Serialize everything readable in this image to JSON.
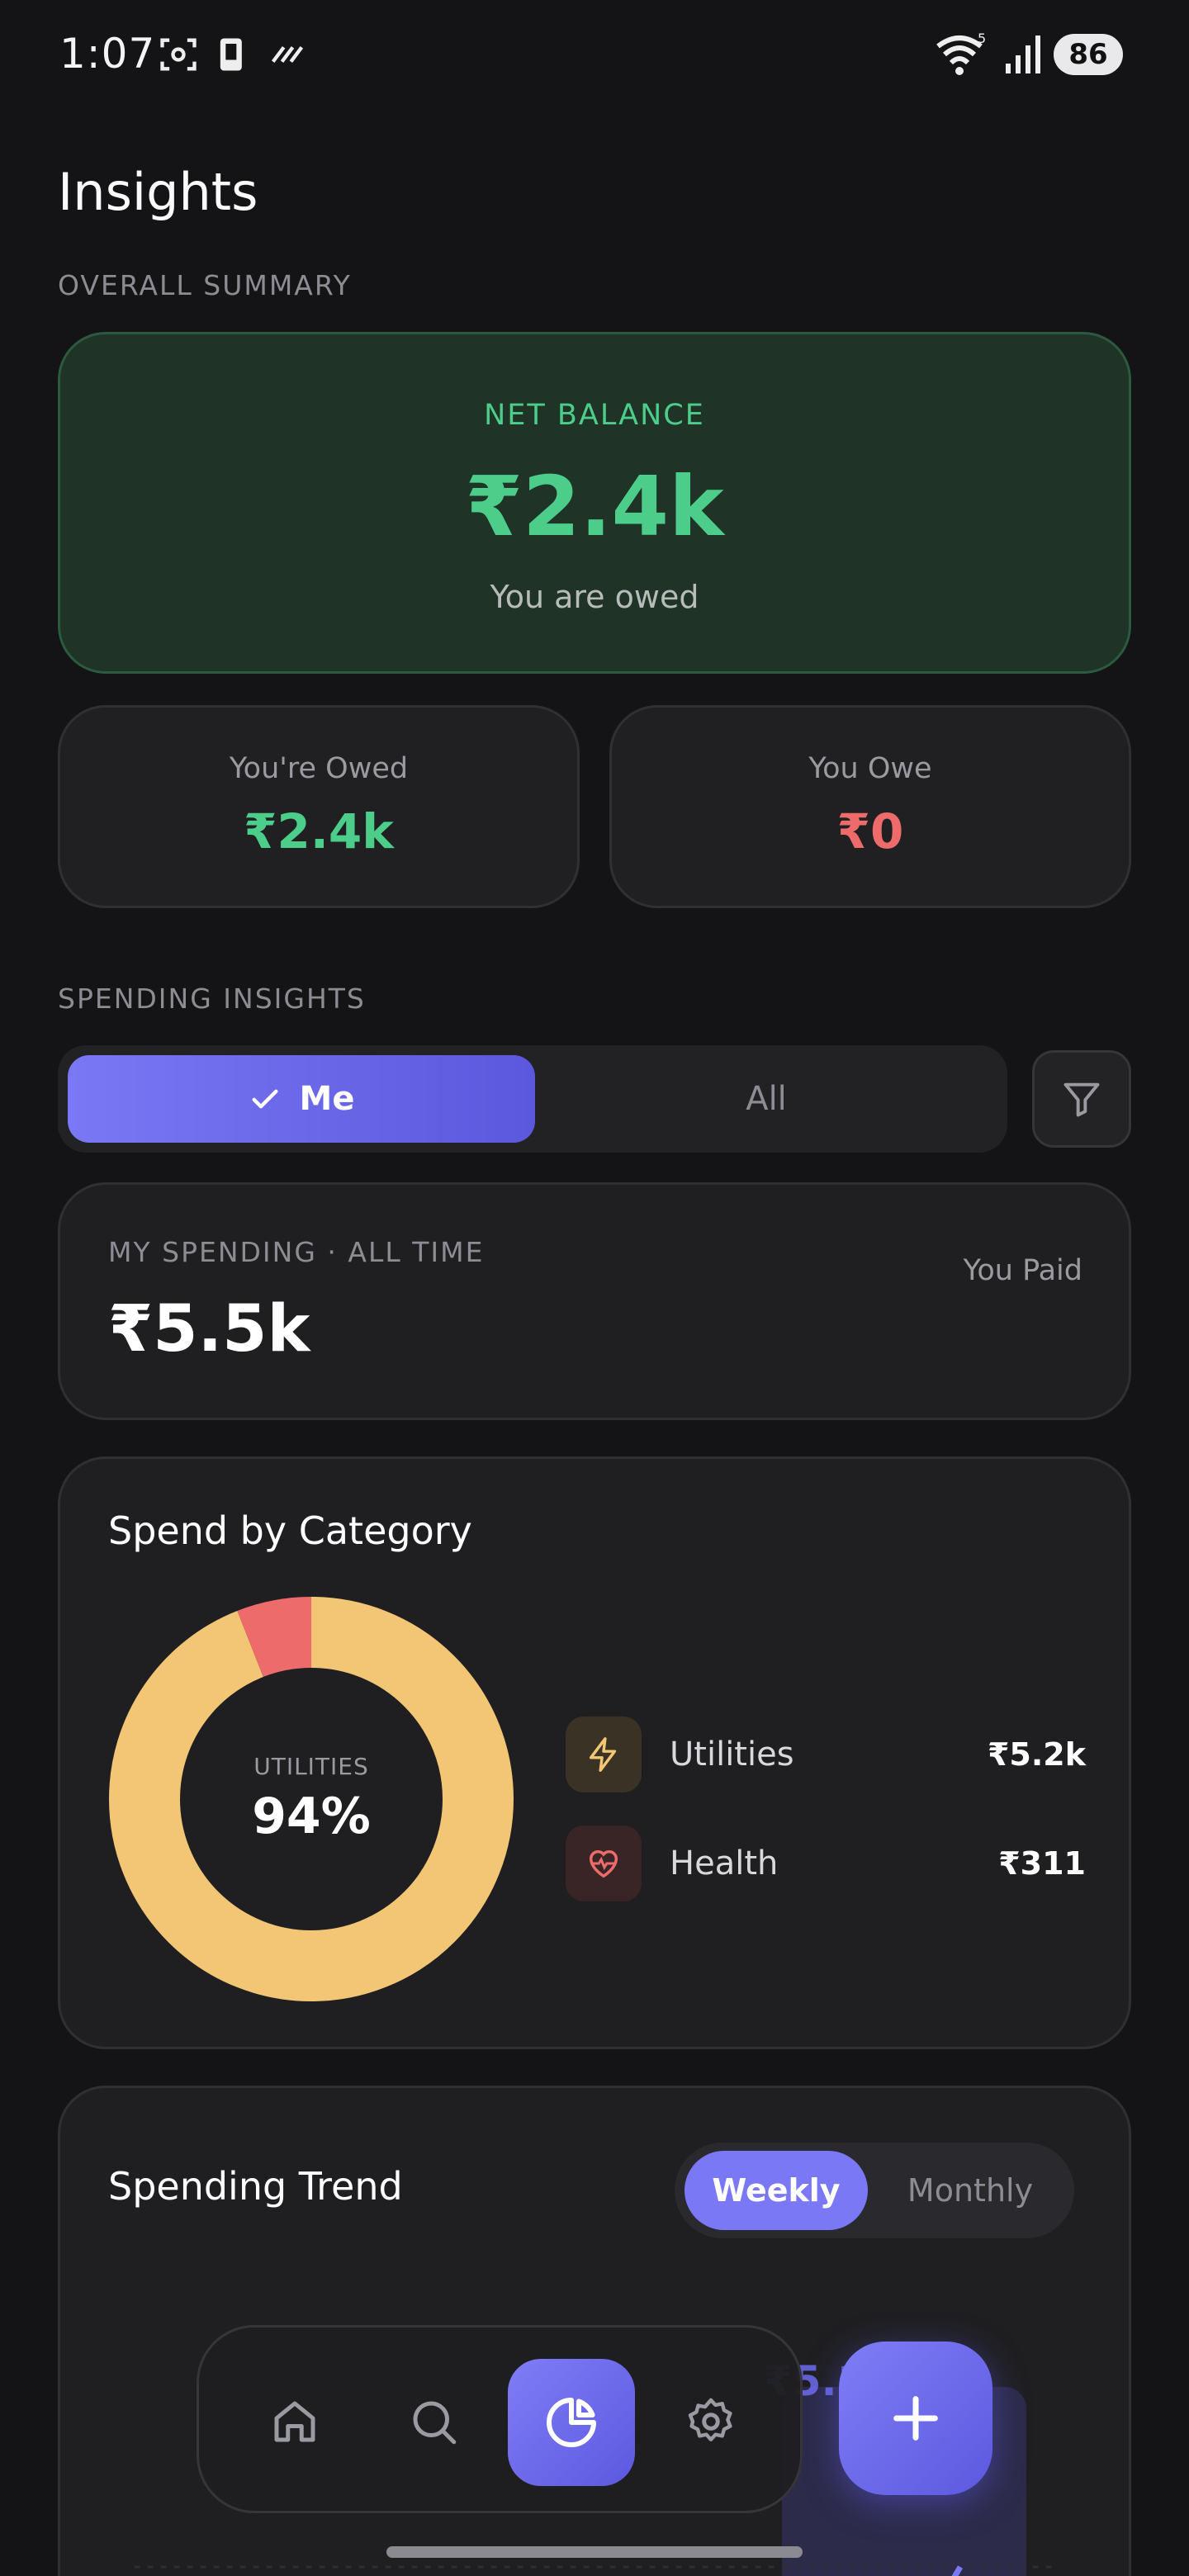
{
  "status_bar": {
    "time": "1:07",
    "battery": "86",
    "signal_badge": "5"
  },
  "header": {
    "title": "Insights"
  },
  "overall_summary": {
    "section_label": "OVERALL SUMMARY",
    "net_balance": {
      "label": "NET BALANCE",
      "value": "₹2.4k",
      "subtitle": "You are owed"
    },
    "youre_owed": {
      "label": "You're Owed",
      "value": "₹2.4k"
    },
    "you_owe": {
      "label": "You Owe",
      "value": "₹0"
    }
  },
  "spending_insights": {
    "section_label": "SPENDING INSIGHTS",
    "segment": {
      "me_label": "Me",
      "all_label": "All",
      "selected": "Me"
    },
    "my_spending": {
      "label": "MY SPENDING · ALL TIME",
      "value": "₹5.5k",
      "side_label": "You Paid"
    }
  },
  "category": {
    "title": "Spend by Category",
    "donut_caption": "UTILITIES",
    "donut_percent": "94%",
    "items": [
      {
        "name": "Utilities",
        "amount": "₹5.2k",
        "icon": "lightning-icon",
        "color": "#f2c674"
      },
      {
        "name": "Health",
        "amount": "₹311",
        "icon": "heart-pulse-icon",
        "color": "#ee6b6b"
      }
    ],
    "chart_data": {
      "type": "pie",
      "categories": [
        "Utilities",
        "Health"
      ],
      "values": [
        94,
        6
      ],
      "colors": [
        "#f2c674",
        "#ee6b6b"
      ]
    }
  },
  "trend": {
    "title": "Spending Trend",
    "toggle": {
      "weekly": "Weekly",
      "monthly": "Monthly",
      "selected": "Weekly"
    },
    "partial_value": "₹5.1"
  },
  "bottom_nav": {
    "items": [
      "home-icon",
      "search-icon",
      "chart-pie-icon",
      "gear-icon"
    ],
    "active": "chart-pie-icon",
    "fab_icon": "plus-icon"
  },
  "colors": {
    "accent": "#6e6cf0",
    "positive": "#4cce8a",
    "negative": "#ee6b6b"
  }
}
